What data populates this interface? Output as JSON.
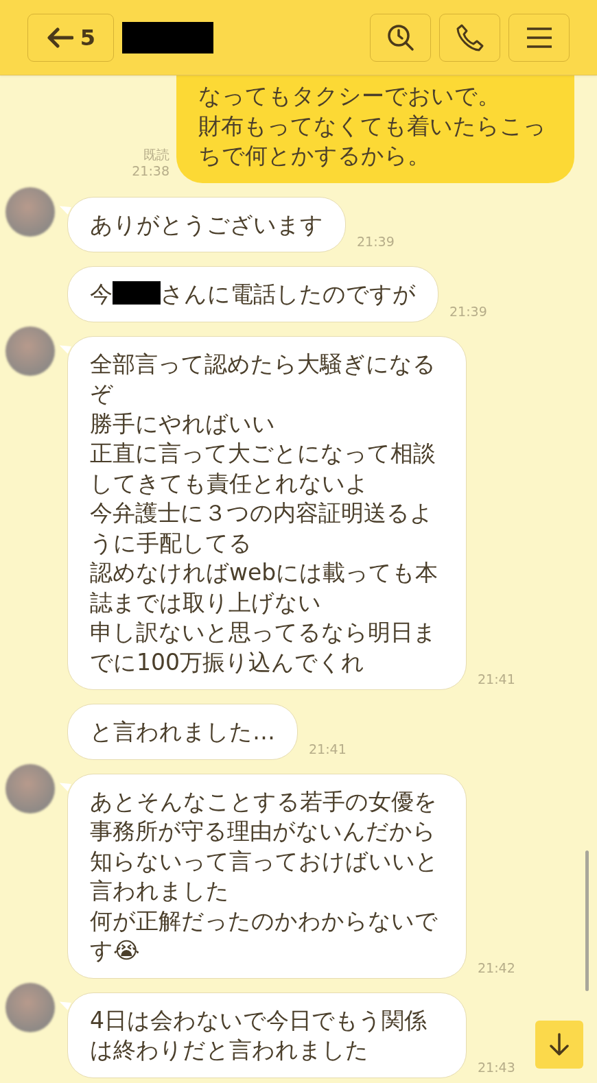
{
  "header": {
    "back_label": "5",
    "name_redacted": true
  },
  "messages": [
    {
      "kind": "sent",
      "lines": [
        "なってもタクシーでおいで。",
        "財布もってなくても着いたらこっちで何とかするから。"
      ],
      "read_label": "既読",
      "time": "21:38"
    },
    {
      "kind": "received",
      "avatar": true,
      "lines": [
        "ありがとうございます"
      ],
      "time": "21:39"
    },
    {
      "kind": "received",
      "avatar": false,
      "segments": [
        "今",
        "さんに電話したのですが"
      ],
      "redacted": true,
      "time": "21:39"
    },
    {
      "kind": "received",
      "avatar": true,
      "lines": [
        "全部言って認めたら大騒ぎになるぞ",
        "勝手にやればいい",
        "正直に言って大ごとになって相談してきても責任とれないよ",
        "今弁護士に３つの内容証明送るように手配してる",
        "認めなければwebには載っても本誌までは取り上げない",
        "申し訳ないと思ってるなら明日までに100万振り込んでくれ"
      ],
      "time": "21:41"
    },
    {
      "kind": "received",
      "avatar": false,
      "lines": [
        "と言われました…"
      ],
      "time": "21:41"
    },
    {
      "kind": "received",
      "avatar": true,
      "lines": [
        "あとそんなことする若手の女優を事務所が守る理由がないんだから知らないって言っておけばいいと言われました",
        "何が正解だったのかわからないです😭"
      ],
      "time": "21:42"
    },
    {
      "kind": "received",
      "avatar": true,
      "lines": [
        "4日は会わないで今日でもう関係は終わりだと言われました"
      ],
      "time": "21:43"
    }
  ]
}
